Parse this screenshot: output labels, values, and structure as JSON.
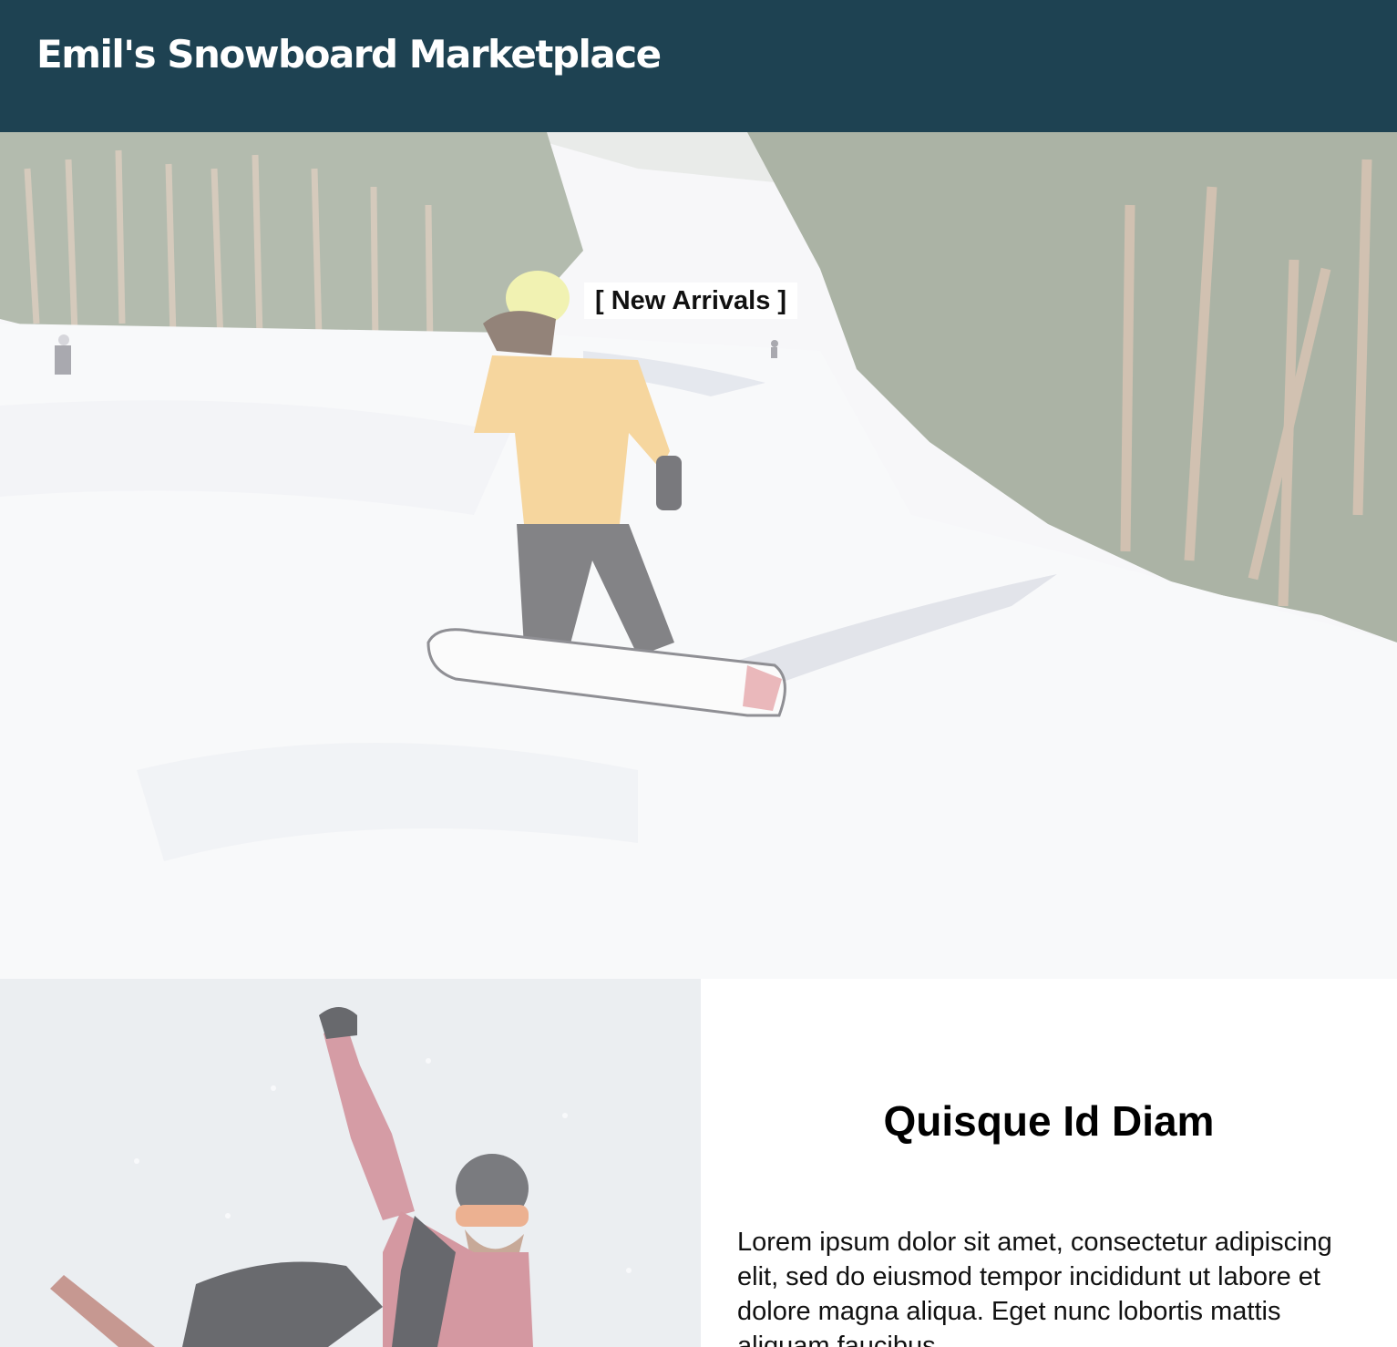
{
  "header": {
    "title": "Emil's Snowboard Marketplace"
  },
  "hero": {
    "badge_label": "[ New Arrivals ]"
  },
  "feature": {
    "heading": "Quisque Id Diam",
    "body": "Lorem ipsum dolor sit amet, consectetur adipiscing elit, sed do eiusmod tempor incididunt ut labore et dolore magna aliqua. Eget nunc lobortis mattis aliquam faucibus"
  },
  "colors": {
    "header_background": "#1e4252",
    "header_text": "#ffffff",
    "page_background": "#ffffff"
  }
}
